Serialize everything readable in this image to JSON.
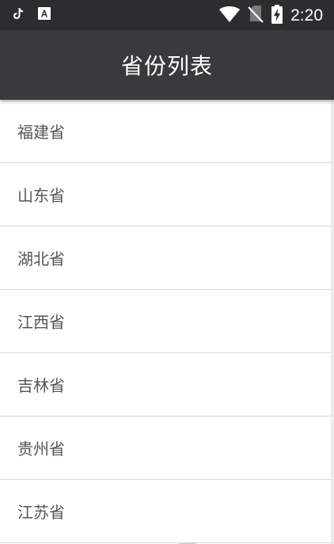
{
  "status_bar": {
    "time": "2:20",
    "icons": [
      "tiktok-icon",
      "text-a-icon",
      "wifi-icon",
      "no-sim-icon",
      "battery-charging-icon"
    ]
  },
  "app_bar": {
    "title": "省份列表"
  },
  "provinces": [
    {
      "label": "福建省"
    },
    {
      "label": "山东省"
    },
    {
      "label": "湖北省"
    },
    {
      "label": "江西省"
    },
    {
      "label": "吉林省"
    },
    {
      "label": "贵州省"
    },
    {
      "label": "江苏省"
    }
  ],
  "colors": {
    "status_bar": "#2d2d2f",
    "app_bar": "#3a3a3d",
    "item_text": "#555555",
    "divider": "#d6d6d6"
  }
}
